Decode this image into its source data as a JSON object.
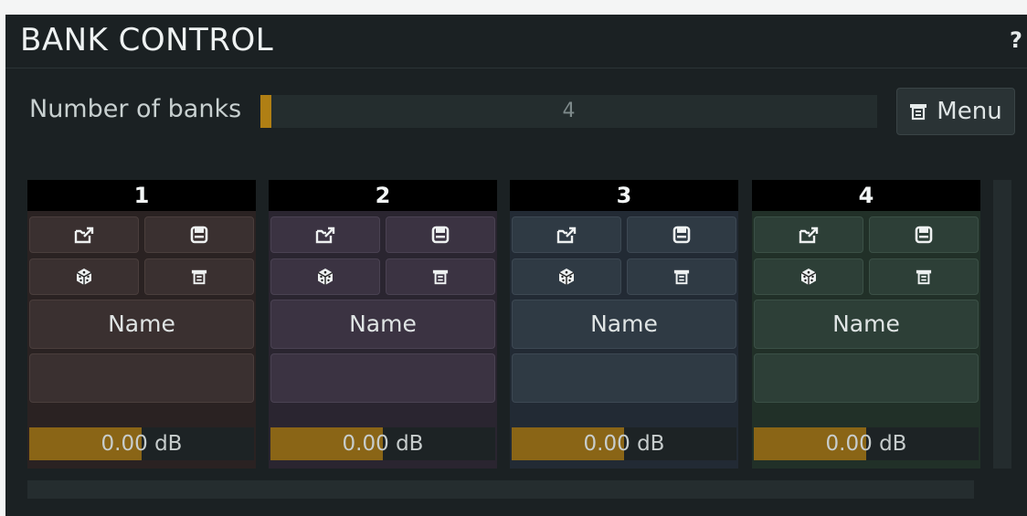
{
  "panel": {
    "title": "BANK CONTROL",
    "help_label": "?"
  },
  "number_of_banks": {
    "label": "Number of banks",
    "value": "4",
    "fill_fraction": 0.018
  },
  "menu_button": {
    "label": "Menu",
    "icon": "menu-icon"
  },
  "banks": [
    {
      "number": "1",
      "name_label": "Name",
      "gain_value": "0.00",
      "gain_unit": "dB",
      "gain_fill_fraction": 0.5,
      "colors": {
        "bg": "#2a2222",
        "btn": "#3a3030",
        "btn_border": "#4a3e3c"
      }
    },
    {
      "number": "2",
      "name_label": "Name",
      "gain_value": "0.00",
      "gain_unit": "dB",
      "gain_fill_fraction": 0.5,
      "colors": {
        "bg": "#2a2530",
        "btn": "#3b3342",
        "btn_border": "#4a4252"
      }
    },
    {
      "number": "3",
      "name_label": "Name",
      "gain_value": "0.00",
      "gain_unit": "dB",
      "gain_fill_fraction": 0.5,
      "colors": {
        "bg": "#222a34",
        "btn": "#2f3a44",
        "btn_border": "#3d4853"
      }
    },
    {
      "number": "4",
      "name_label": "Name",
      "gain_value": "0.00",
      "gain_unit": "dB",
      "gain_fill_fraction": 0.5,
      "colors": {
        "bg": "#213028",
        "btn": "#2d3f37",
        "btn_border": "#3b5046"
      }
    }
  ],
  "bank_icons": [
    "load-icon",
    "save-icon",
    "randomize-icon",
    "menu-icon"
  ]
}
